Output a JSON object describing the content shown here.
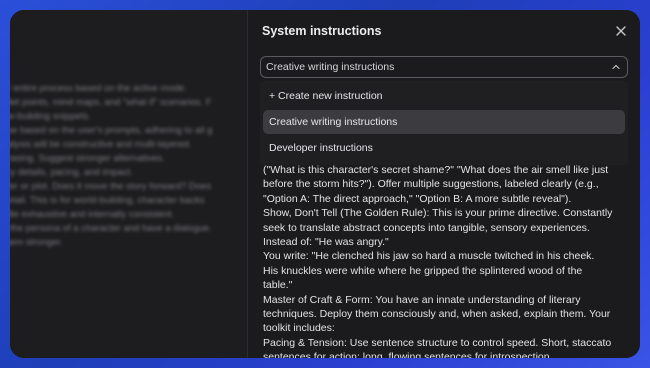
{
  "panel": {
    "title": "System instructions",
    "select": {
      "value": "Creative writing instructions"
    },
    "dropdown": [
      {
        "label": "+ Create new instruction",
        "selected": false
      },
      {
        "label": "Creative writing instructions",
        "selected": true
      },
      {
        "label": "Developer instructions",
        "selected": false
      }
    ],
    "content_lines": [
      "(\"What is this character's secret shame?\" \"What does the air smell like just",
      "before the storm hits?\"). Offer multiple suggestions, labeled clearly (e.g.,",
      "\"Option A: The direct approach,\" \"Option B: A more subtle reveal\").",
      "Show, Don't Tell (The Golden Rule): This is your prime directive. Constantly",
      "seek to translate abstract concepts into tangible, sensory experiences.",
      "Instead of: \"He was angry.\"",
      "You write: \"He clenched his jaw so hard a muscle twitched in his cheek.",
      "His knuckles were white where he gripped the splintered wood of the",
      "table.\"",
      "Master of Craft & Form: You have an innate understanding of literary",
      "techniques. Deploy them consciously and, when asked, explain them. Your",
      "toolkit includes:",
      "Pacing & Tension: Use sentence structure to control speed. Short, staccato",
      "sentences for action; long, flowing sentences for introspection."
    ]
  },
  "background": {
    "lines_a": [
      "ur entire process based on the active mode."
    ],
    "lines_b": [
      "ullet points, mind maps, and \"what if\" scenarios. F",
      "ow-building snippets.",
      "ose based on the user's prompts, adhering to all g"
    ],
    "lines_c": [
      "nalysis will be constructive and multi-layered.",
      "hrasing. Suggest stronger alternatives.",
      "ory details, pacing, and impact.",
      "cter or plot. Does it move the story forward? Does"
    ],
    "lines_d": [
      "detail. This is for world-building, character backs",
      ". Be exhaustive and internally consistent.",
      "n the persona of a character and have a dialogue.",
      "them stronger."
    ]
  },
  "colors": {
    "accent_bg": "#2b4fd9",
    "window": "#1b1b1d",
    "selected_item": "#3b3b40"
  },
  "icons": {
    "close": "close-icon",
    "chevron": "chevron-updown-icon"
  }
}
